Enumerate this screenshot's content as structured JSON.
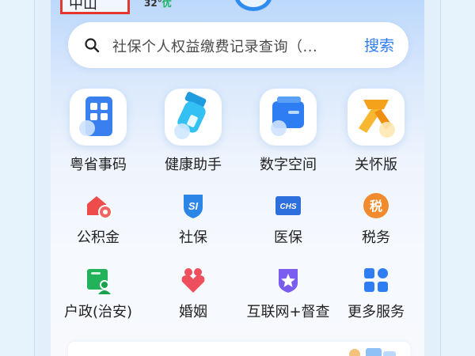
{
  "top": {
    "city": "中山",
    "weather": "32°",
    "air_quality": "优"
  },
  "search": {
    "placeholder": "社保个人权益缴费记录查询（...",
    "button": "搜索"
  },
  "featured": [
    {
      "label": "粤省事码",
      "icon": "qr-code-icon",
      "color": "#3a7ff0"
    },
    {
      "label": "健康助手",
      "icon": "health-assistant-icon",
      "color": "#2ab4f2"
    },
    {
      "label": "数字空间",
      "icon": "digital-space-icon",
      "color": "#2f7df2"
    },
    {
      "label": "关怀版",
      "icon": "care-scarf-icon",
      "color": "#f4a21c"
    }
  ],
  "services_row1": [
    {
      "label": "公积金",
      "icon": "housing-fund-icon",
      "color": "#ee4b4b"
    },
    {
      "label": "社保",
      "icon": "social-security-icon",
      "color": "#2b86e8"
    },
    {
      "label": "医保",
      "icon": "medical-insurance-icon",
      "color": "#2d6fdc"
    },
    {
      "label": "税务",
      "icon": "tax-icon",
      "color": "#f28a2e"
    }
  ],
  "services_row2": [
    {
      "label": "户政(治安)",
      "icon": "household-registration-icon",
      "color": "#21b25a"
    },
    {
      "label": "婚姻",
      "icon": "marriage-icon",
      "color": "#ef4f5c"
    },
    {
      "label": "互联网+督查",
      "icon": "supervision-icon",
      "color": "#7a5cf0"
    },
    {
      "label": "更多服务",
      "icon": "more-services-icon",
      "color": "#2f7df2"
    }
  ],
  "icon_text": {
    "social_security": "SI",
    "medical": "CHS",
    "tax": "税"
  }
}
